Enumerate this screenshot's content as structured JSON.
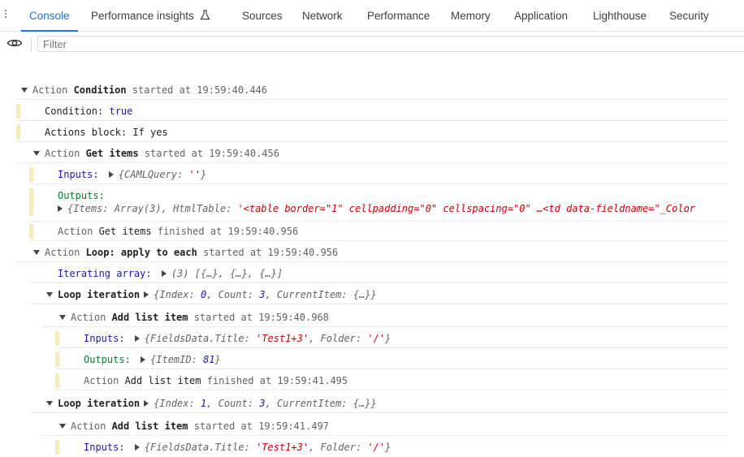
{
  "tabs": [
    "Console",
    "Performance insights",
    "Sources",
    "Network",
    "Performance",
    "Memory",
    "Application",
    "Lighthouse",
    "Security"
  ],
  "filter": {
    "placeholder": "Filter"
  },
  "console": {
    "l1": {
      "pre": "Action ",
      "bold": "Condition",
      "post": " started at 19:59:40.446"
    },
    "l2": {
      "label": "Condition: ",
      "value": "true"
    },
    "l3": {
      "text": "Actions block: If yes"
    },
    "l4": {
      "pre": "Action ",
      "bold": "Get items",
      "post": " started at 19:59:40.456"
    },
    "l5": {
      "label": "Inputs: ",
      "obj_open": "{",
      "k1": "CAMLQuery",
      "sep": ": ",
      "v1": "''",
      "obj_close": "}"
    },
    "l6": {
      "label": "Outputs:"
    },
    "l7": {
      "a": "{Items: Array(3), HtmlTable: ",
      "s": "'<table border=\"1\" cellpadding=\"0\" cellspacing=\"0\" …<td data-fieldname=\"_Color"
    },
    "l8": {
      "pre": "Action ",
      "bold": "Get items",
      "post": " finished at 19:59:40.956"
    },
    "l9": {
      "pre": "Action ",
      "bold": "Loop: apply to each",
      "post": " started at 19:59:40.956"
    },
    "l10": {
      "label": "Iterating array: ",
      "value": "(3) [{…}, {…}, {…}]"
    },
    "l11": {
      "bold": "Loop iteration",
      "a": "{Index: ",
      "n1": "0",
      "b": ", Count: ",
      "n2": "3",
      "c": ", CurrentItem: {…}}"
    },
    "l12": {
      "pre": "Action ",
      "bold": "Add list item",
      "post": " started at 19:59:40.968"
    },
    "l13": {
      "label": "Inputs: ",
      "a": "{FieldsData.Title: ",
      "s1": "'Test1+3'",
      "b": ", Folder: ",
      "s2": "'/'",
      "c": "}"
    },
    "l14": {
      "label": "Outputs: ",
      "a": "{ItemID: ",
      "n": "81",
      "c": "}"
    },
    "l15": {
      "pre": "Action ",
      "bold": "Add list item",
      "post": " finished at 19:59:41.495"
    },
    "l16": {
      "bold": "Loop iteration",
      "a": "{Index: ",
      "n1": "1",
      "b": ", Count: ",
      "n2": "3",
      "c": ", CurrentItem: {…}}"
    },
    "l17": {
      "pre": "Action ",
      "bold": "Add list item",
      "post": " started at 19:59:41.497"
    },
    "l18": {
      "label": "Inputs: ",
      "a": "{FieldsData.Title: ",
      "s1": "'Test1+3'",
      "b": ", Folder: ",
      "s2": "'/'",
      "c": "}"
    }
  }
}
